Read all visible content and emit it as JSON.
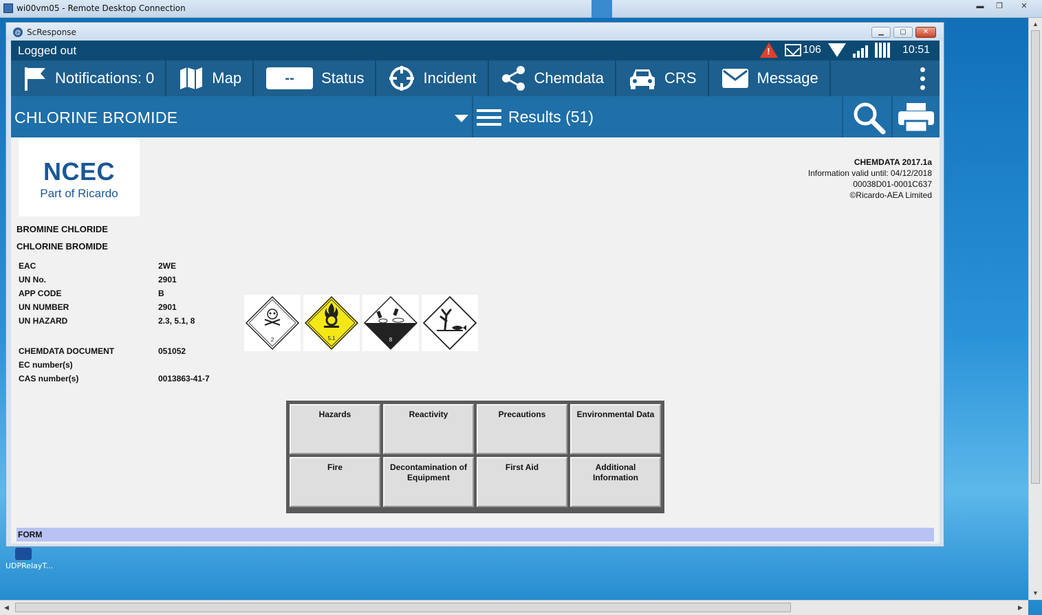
{
  "rdp": {
    "title": "wi00vm05 - Remote Desktop Connection",
    "controls": {
      "minimize": "▬",
      "restore": "❐",
      "close": "✕"
    }
  },
  "desktop": {
    "icon_label": "UDPRelayT..."
  },
  "app": {
    "title": "ScResponse",
    "icon_letter": "@",
    "status_bar": {
      "login_status": "Logged out",
      "message_count": "106",
      "time": "10:51",
      "alert_mark": "!"
    },
    "nav": {
      "notifications_label": "Notifications: 0",
      "map_label": "Map",
      "status_value": "--",
      "status_label": "Status",
      "incident_label": "Incident",
      "chemdata_label": "Chemdata",
      "crs_label": "CRS",
      "message_label": "Message"
    },
    "search": {
      "chemical_name": "CHLORINE BROMIDE",
      "results_label": "Results (51)"
    }
  },
  "document": {
    "logo": {
      "main": "NCEC",
      "sub": "Part of Ricardo"
    },
    "meta": {
      "version": "CHEMDATA 2017.1a",
      "valid_until": "Information valid until: 04/12/2018",
      "record_id": "00038D01-0001C637",
      "copyright": "©Ricardo-AEA Limited"
    },
    "names": [
      "BROMINE CHLORIDE",
      "CHLORINE BROMIDE"
    ],
    "properties": [
      {
        "key": "EAC",
        "value": "2WE"
      },
      {
        "key": "UN No.",
        "value": "2901"
      },
      {
        "key": "APP CODE",
        "value": "B"
      },
      {
        "key": "UN NUMBER",
        "value": "2901"
      },
      {
        "key": "UN HAZARD",
        "value": "2.3, 5.1, 8"
      },
      {
        "key": "CHEMDATA DOCUMENT",
        "value": "051052"
      },
      {
        "key": "EC number(s)",
        "value": ""
      },
      {
        "key": "CAS number(s)",
        "value": "0013863-41-7"
      }
    ],
    "placards": [
      {
        "name": "toxic-gas-placard",
        "number": "2",
        "color": "#ffffff"
      },
      {
        "name": "oxidizer-placard",
        "number": "5.1",
        "color": "#f3e716"
      },
      {
        "name": "corrosive-placard",
        "number": "8",
        "color": "#ffffff"
      },
      {
        "name": "environment-hazard-placard",
        "number": "",
        "color": "#ffffff"
      }
    ],
    "section_buttons": [
      "Hazards",
      "Reactivity",
      "Precautions",
      "Environmental Data",
      "Fire",
      "Decontamination of Equipment",
      "First Aid",
      "Additional Information"
    ],
    "form_label": "FORM"
  },
  "colors": {
    "status_bar": "#0d4a73",
    "nav_bar": "#1d5f8e",
    "search_bar": "#1f6fa8",
    "form_bar": "#b8c3f4",
    "logo_blue": "#1a5798"
  }
}
